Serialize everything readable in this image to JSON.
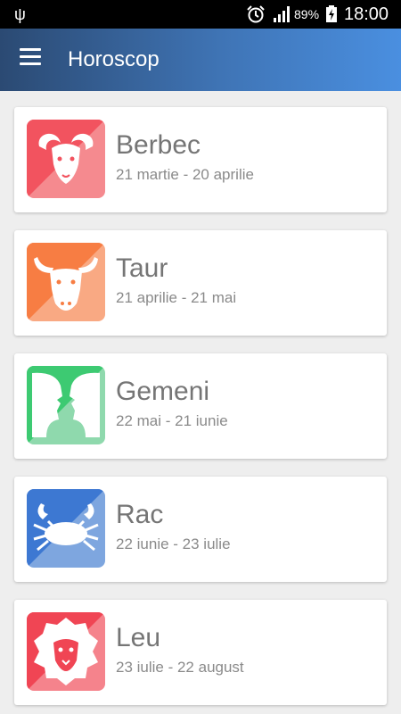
{
  "status_bar": {
    "battery": "89%",
    "time": "18:00"
  },
  "app_bar": {
    "title": "Horoscop"
  },
  "signs": [
    {
      "name": "Berbec",
      "dates": "21 martie - 20 aprilie",
      "icon": "ram-icon",
      "color_a": "#f2535f",
      "color_b": "#f58a8f"
    },
    {
      "name": "Taur",
      "dates": "21 aprilie - 21 mai",
      "icon": "bull-icon",
      "color_a": "#f77d43",
      "color_b": "#f9a983"
    },
    {
      "name": "Gemeni",
      "dates": "22 mai - 21 iunie",
      "icon": "twins-icon",
      "color_a": "#3dca72",
      "color_b": "#8fd9ad"
    },
    {
      "name": "Rac",
      "dates": "22 iunie - 23 iulie",
      "icon": "crab-icon",
      "color_a": "#3d78d2",
      "color_b": "#7ea6df"
    },
    {
      "name": "Leu",
      "dates": "23 iulie - 22 august",
      "icon": "lion-icon",
      "color_a": "#f04554",
      "color_b": "#f5838c"
    }
  ]
}
